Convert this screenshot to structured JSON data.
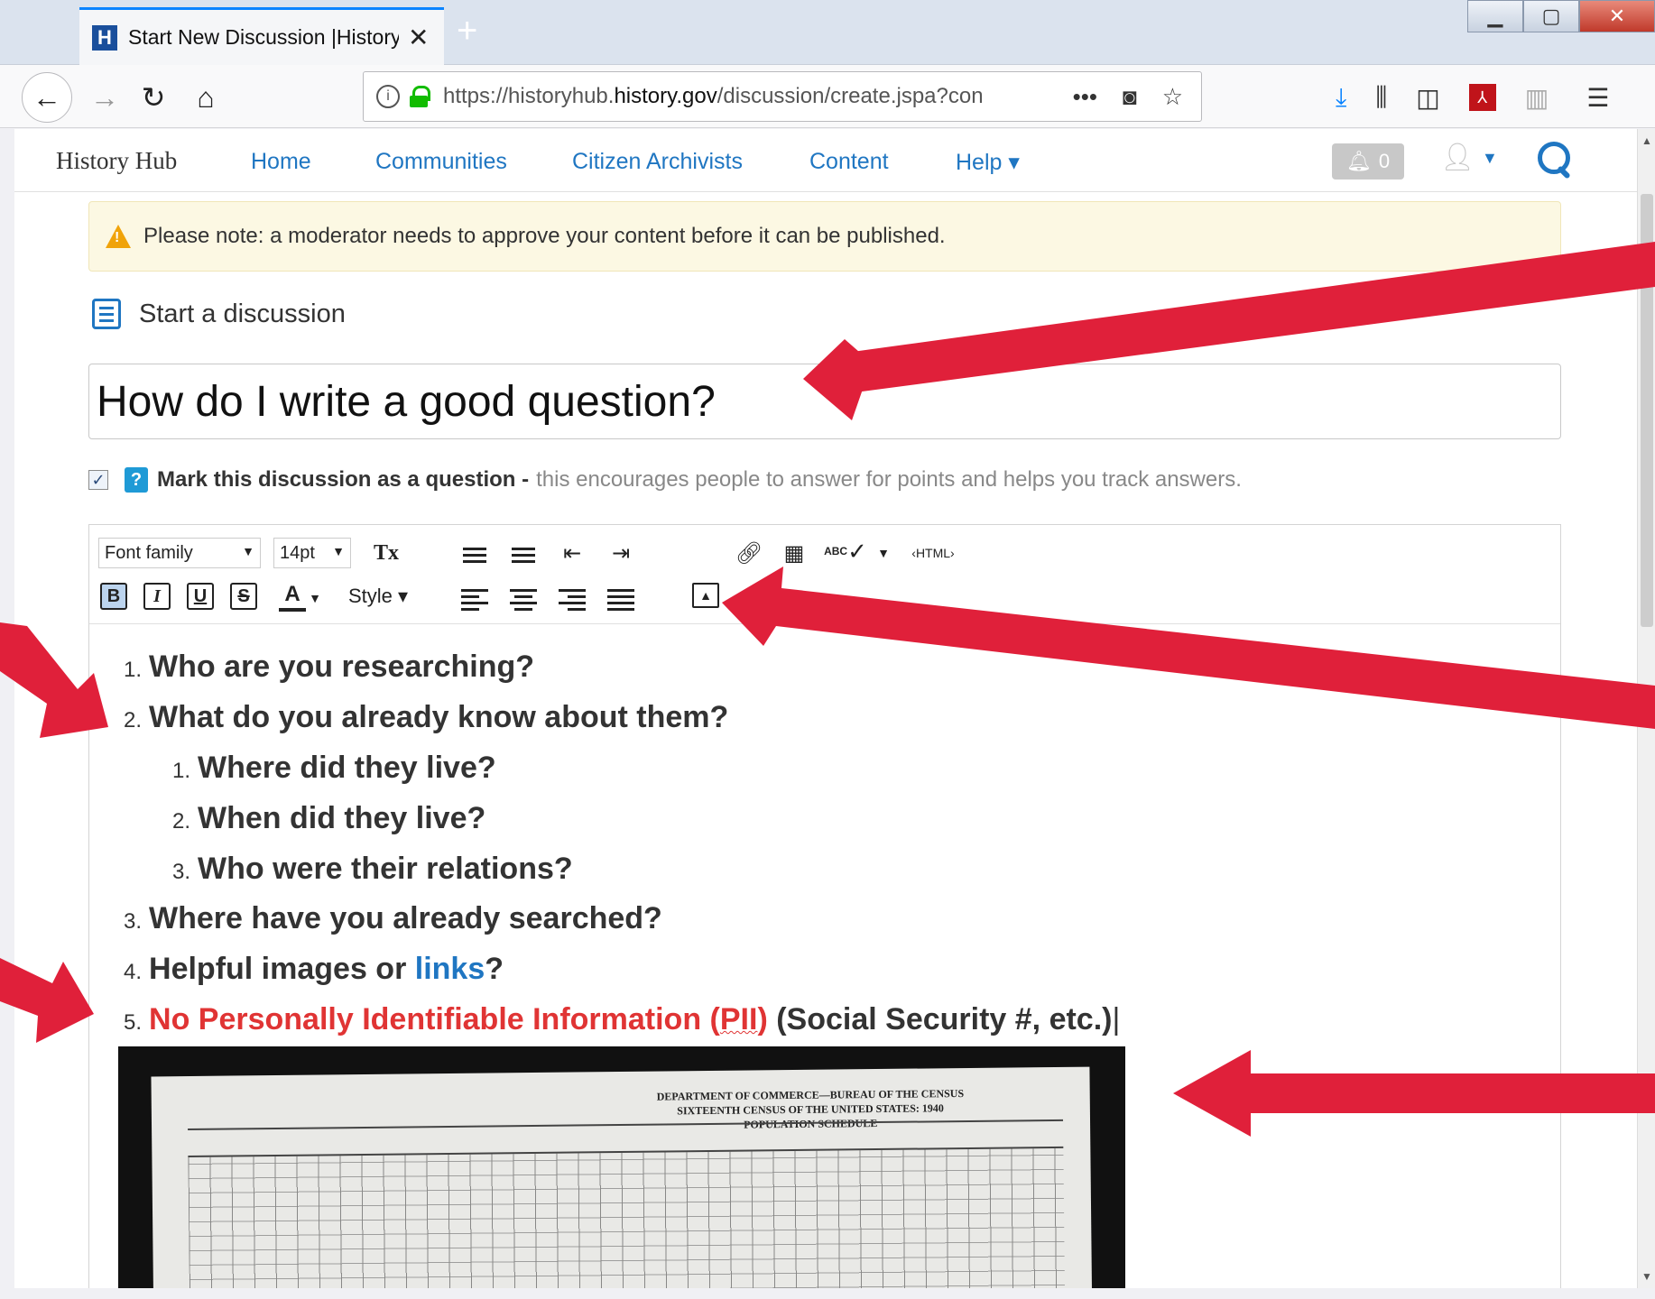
{
  "browser": {
    "tab_title": "Start New Discussion |History Hub",
    "url_prefix": "https://historyhub.",
    "url_domain": "history.gov",
    "url_path": "/discussion/create.jspa?con",
    "new_tab": "+",
    "tab_close": "✕",
    "favicon_letter": "H"
  },
  "site": {
    "brand": "History Hub",
    "nav": [
      "Home",
      "Communities",
      "Citizen Archivists",
      "Content",
      "Help ▾"
    ],
    "notif_count": "0"
  },
  "notice": {
    "text": "Please note: a moderator needs to approve your content before it can be published."
  },
  "composer": {
    "heading": "Start a discussion",
    "subject_value": "How do I write a good question?",
    "mark_label": "Mark this discussion as a question -",
    "mark_desc": "this encourages people to answer for points and helps you track answers.",
    "mark_checked": true
  },
  "toolbar": {
    "font_family": "Font family",
    "font_size": "14pt",
    "style_label": "Style ▾",
    "html_label": "‹HTML›",
    "bold": "B",
    "italic": "I",
    "underline": "U",
    "strike": "S",
    "font_color": "A",
    "clear_format": "Tx",
    "spellcheck": "ABC"
  },
  "list": {
    "item1": "Who are you researching?",
    "item2": "What do you already know about them?",
    "sub1": "Where did they live?",
    "sub2": "When did they live?",
    "sub3": "Who were their relations?",
    "item3": "Where have you already searched?",
    "item4_pre": "Helpful images or ",
    "item4_link": "links",
    "item4_post": "?",
    "item5_red_pre": "No Personally Identifiable Information (",
    "item5_red_pii": "PII",
    "item5_red_post": ")",
    "item5_tail": " (Social Security #, etc.)",
    "n1": "1.",
    "n2": "2.",
    "n3": "3.",
    "n4": "4.",
    "n5": "5."
  },
  "census": {
    "line1": "DEPARTMENT OF COMMERCE—BUREAU OF THE CENSUS",
    "line2": "SIXTEENTH CENSUS OF THE UNITED STATES: 1940",
    "line3": "POPULATION SCHEDULE"
  },
  "colors": {
    "link": "#1f76c2",
    "pii_red": "#e03434",
    "arrow_red": "#e0203a",
    "notice_bg": "#fcf8e3"
  }
}
